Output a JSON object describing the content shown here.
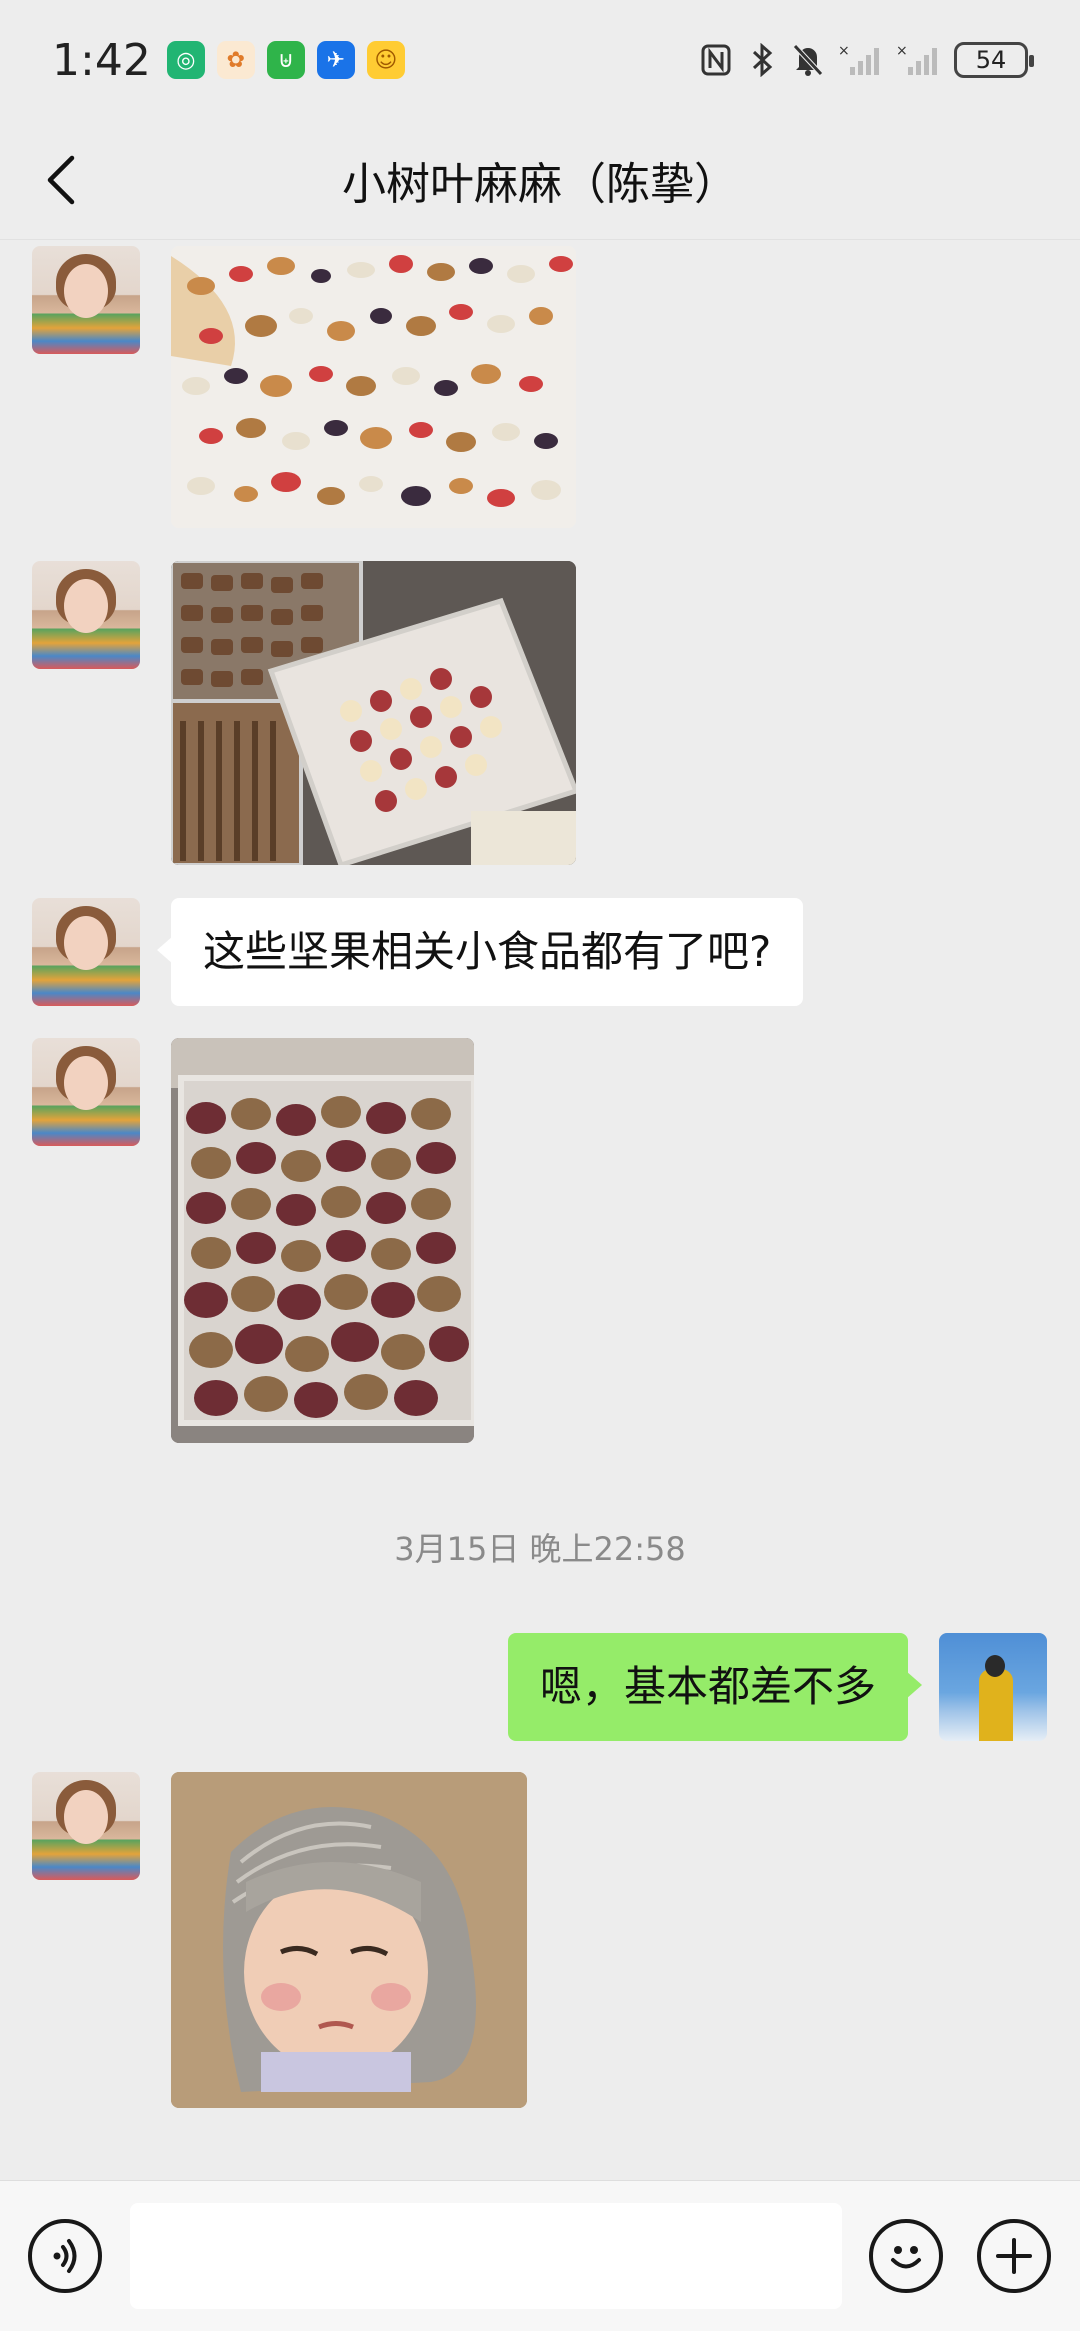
{
  "status": {
    "time": "1:42",
    "battery": "54",
    "app_icons": [
      {
        "name": "app-icon-green",
        "color": "#21b573",
        "glyph": "◎"
      },
      {
        "name": "app-icon-orange",
        "color": "#f7f1e6",
        "glyph": "✿"
      },
      {
        "name": "app-icon-teal",
        "color": "#2fb44a",
        "glyph": "⊎"
      },
      {
        "name": "app-icon-blue",
        "color": "#1a73e8",
        "glyph": "✈"
      },
      {
        "name": "app-icon-yellow",
        "color": "#ffcc33",
        "glyph": "☺"
      }
    ]
  },
  "header": {
    "title": "小树叶麻麻（陈挚）"
  },
  "messages": {
    "text1": "这些坚果相关小食品都有了吧?",
    "timestamp": "3月15日 晚上22:58",
    "text2": "嗯，基本都差不多"
  },
  "colors": {
    "bubble_out": "#95ec69",
    "bubble_in": "#ffffff",
    "background": "#ededed"
  },
  "input": {
    "value": "",
    "placeholder": ""
  }
}
